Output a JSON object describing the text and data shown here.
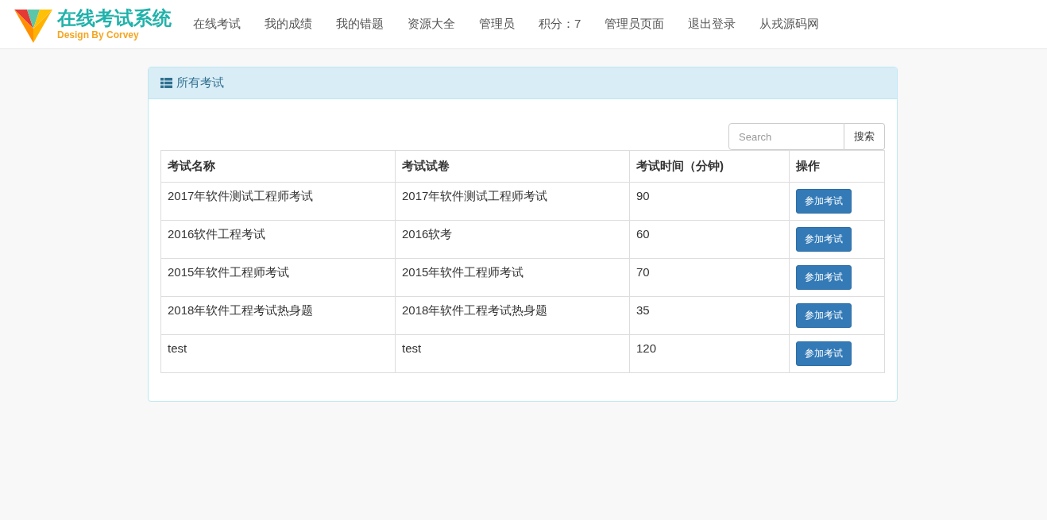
{
  "brand": {
    "title": "在线考试系统",
    "subtitle": "Design By Corvey"
  },
  "nav": [
    "在线考试",
    "我的成绩",
    "我的错题",
    "资源大全",
    "管理员",
    "积分：7",
    "管理员页面",
    "退出登录",
    "从戎源码网"
  ],
  "panel": {
    "title": "所有考试",
    "search": {
      "placeholder": "Search",
      "button": "搜索"
    },
    "table": {
      "columns": [
        "考试名称",
        "考试试卷",
        "考试时间（分钟)",
        "操作"
      ],
      "rows": [
        {
          "name": "2017年软件测试工程师考试",
          "paper": "2017年软件测试工程师考试",
          "minutes": "90",
          "action": "参加考试"
        },
        {
          "name": "2016软件工程考试",
          "paper": "2016软考",
          "minutes": "60",
          "action": "参加考试"
        },
        {
          "name": "2015年软件工程师考试",
          "paper": "2015年软件工程师考试",
          "minutes": "70",
          "action": "参加考试"
        },
        {
          "name": "2018年软件工程考试热身题",
          "paper": "2018年软件工程考试热身题",
          "minutes": "35",
          "action": "参加考试"
        },
        {
          "name": "test",
          "paper": "test",
          "minutes": "120",
          "action": "参加考试"
        }
      ]
    }
  }
}
